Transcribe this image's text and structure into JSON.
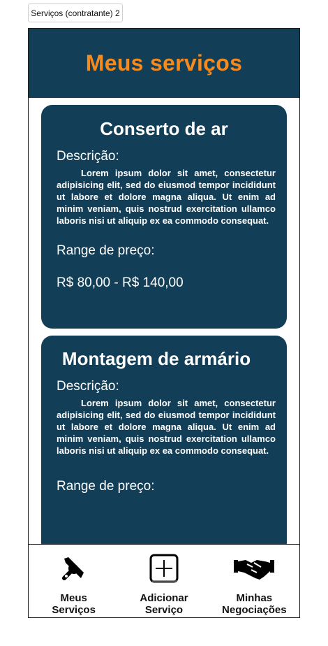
{
  "browser_tab": {
    "label": "Serviços (contratante) 2"
  },
  "header": {
    "title": "Meus serviços"
  },
  "cards": [
    {
      "title": "Conserto de ar",
      "description_label": "Descrição:",
      "description": "Lorem ipsum dolor sit amet, consectetur adipisicing elit, sed do eiusmod tempor incididunt ut labore et dolore magna aliqua. Ut enim ad minim veniam, quis nostrud exercitation ullamco laboris nisi ut aliquip ex ea commodo consequat.",
      "range_label": "Range de preço:",
      "price_range": "R$ 80,00 - R$ 140,00"
    },
    {
      "title": "Montagem de armário",
      "description_label": "Descrição:",
      "description": "Lorem ipsum dolor sit amet, consectetur adipisicing elit, sed do eiusmod tempor incididunt ut labore et dolore magna aliqua. Ut enim ad minim veniam, quis nostrud exercitation ullamco laboris nisi ut aliquip ex ea commodo consequat.",
      "range_label": "Range de preço:"
    }
  ],
  "bottom_nav": [
    {
      "label": "Meus\nServiços",
      "icon": "tools-icon"
    },
    {
      "label": "Adicionar\nServiço",
      "icon": "add-square-icon"
    },
    {
      "label": "Minhas\nNegociações",
      "icon": "handshake-icon"
    }
  ],
  "colors": {
    "header_bg": "#123e57",
    "title": "#f58a1f",
    "card_bg": "#123e57"
  }
}
